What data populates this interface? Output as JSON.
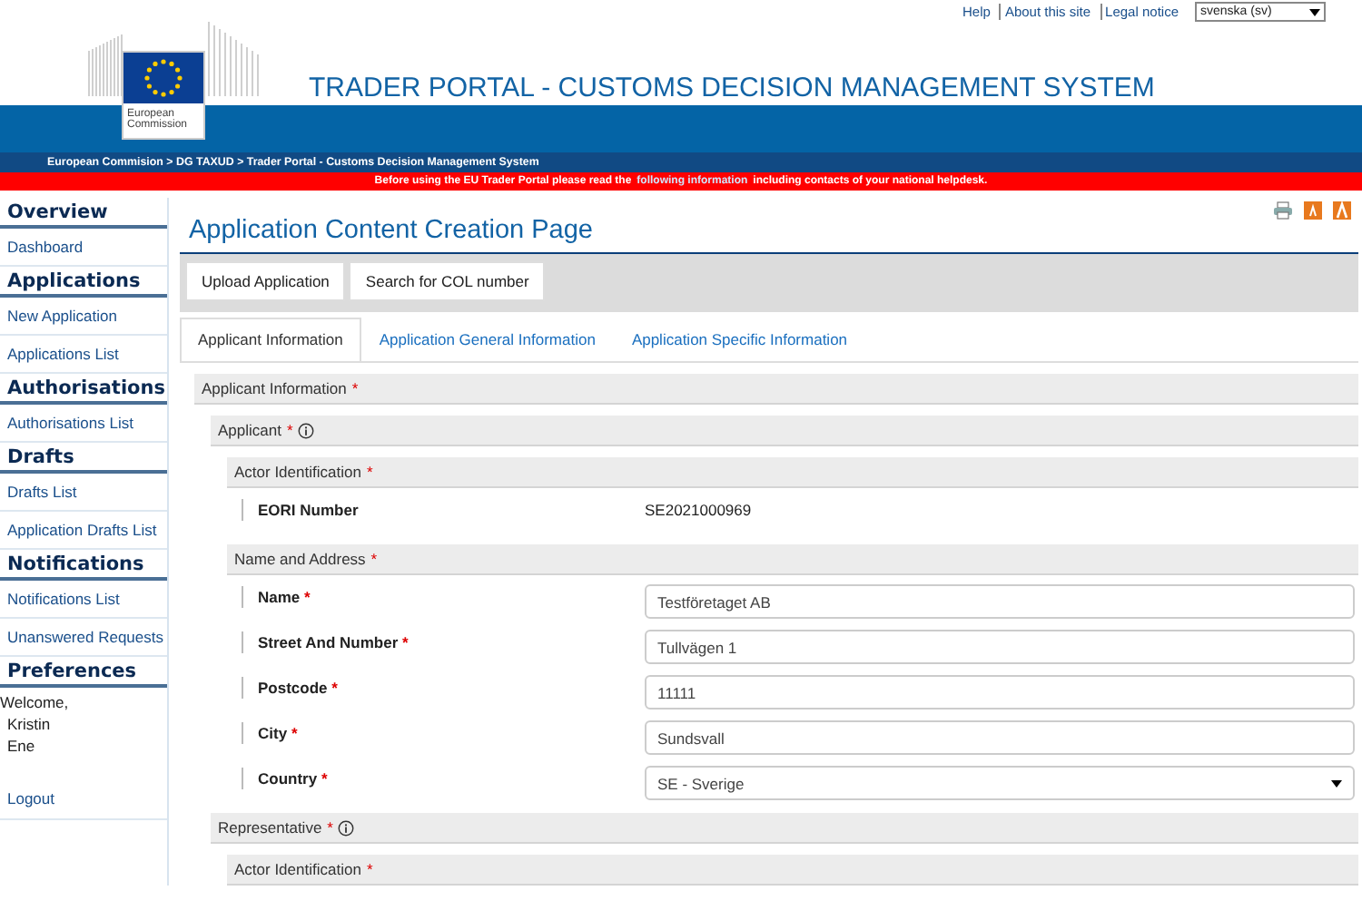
{
  "top_links": [
    {
      "label": "Help"
    },
    {
      "label": "About this site"
    },
    {
      "label": "Legal notice"
    }
  ],
  "language": {
    "value": "svenska (sv)"
  },
  "logo": {
    "lines": [
      "European",
      "Commission"
    ]
  },
  "site_title": "TRADER PORTAL - CUSTOMS DECISION MANAGEMENT SYSTEM",
  "breadcrumb": "European Commision > DG TAXUD > Trader Portal - Customs Decision Management System",
  "notice": {
    "before": "Before using the EU Trader Portal please read the",
    "link": "following information",
    "after": "including contacts of your national helpdesk."
  },
  "sidebar": [
    {
      "title": "Overview",
      "items": [
        {
          "label": "Dashboard"
        }
      ]
    },
    {
      "title": "Applications",
      "items": [
        {
          "label": "New Application"
        },
        {
          "label": "Applications List"
        }
      ]
    },
    {
      "title": "Authorisations",
      "items": [
        {
          "label": "Authorisations List"
        }
      ]
    },
    {
      "title": "Drafts",
      "items": [
        {
          "label": "Drafts List"
        },
        {
          "label": "Application Drafts List"
        }
      ]
    },
    {
      "title": "Notifications",
      "items": [
        {
          "label": "Notifications List"
        },
        {
          "label": "Unanswered Requests"
        }
      ]
    },
    {
      "title": "Preferences"
    }
  ],
  "user": {
    "welcome": "Welcome,",
    "first_name": "Kristin",
    "last_name": "Ene",
    "logout": "Logout"
  },
  "page_title": "Application Content Creation Page",
  "toolbar": [
    {
      "label": "Upload Application"
    },
    {
      "label": "Search for COL number"
    }
  ],
  "tabs": [
    {
      "label": "Applicant Information",
      "selected": true
    },
    {
      "label": "Application General Information",
      "selected": false
    },
    {
      "label": "Application Specific Information",
      "selected": false
    }
  ],
  "form": [
    {
      "title": "Applicant Information",
      "required_mark": "*",
      "info": false,
      "children": [
        {
          "title": "Applicant",
          "required_mark": "*",
          "info": true,
          "children": [
            {
              "title": "Actor Identification",
              "required_mark": "*",
              "info": false,
              "fields": [
                {
                  "kind": "readonly",
                  "label": "EORI Number",
                  "value": "SE2021000969"
                }
              ]
            },
            {
              "title": "Name and Address",
              "required_mark": "*",
              "info": false,
              "fields": [
                {
                  "kind": "text",
                  "label": "Name",
                  "required_mark": "*",
                  "value": "Testföretaget AB"
                },
                {
                  "kind": "text",
                  "label": "Street And Number",
                  "required_mark": "*",
                  "value": "Tullvägen 1"
                },
                {
                  "kind": "text",
                  "label": "Postcode",
                  "required_mark": "*",
                  "value": "11111"
                },
                {
                  "kind": "text",
                  "label": "City",
                  "required_mark": "*",
                  "value": "Sundsvall"
                },
                {
                  "kind": "select",
                  "label": "Country",
                  "required_mark": "*",
                  "value": "SE - Sverige"
                }
              ]
            }
          ]
        },
        {
          "title": "Representative",
          "required_mark": "*",
          "info": true,
          "children": [
            {
              "title": "Actor Identification",
              "required_mark": "*",
              "info": false
            }
          ]
        }
      ]
    }
  ]
}
